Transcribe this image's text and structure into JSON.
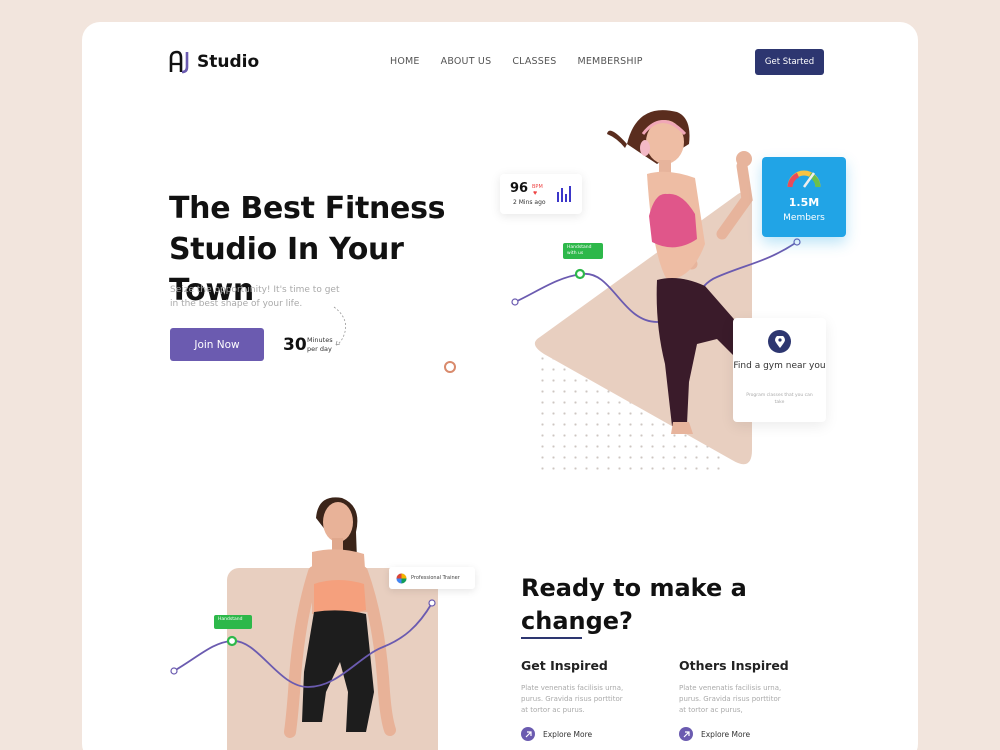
{
  "brand": {
    "name": "Studio",
    "accent": "#6b5bb0",
    "navy": "#2d3670",
    "background": "#f2e5dd"
  },
  "nav": {
    "items": [
      "HOME",
      "ABOUT US",
      "CLASSES",
      "MEMBERSHIP"
    ],
    "cta": "Get Started"
  },
  "hero": {
    "title": "The Best Fitness Studio In Your Town",
    "subtitle": "Seize the opportunity! It's time to get in the best shape of your life.",
    "join_label": "Join Now",
    "minutes_value": "30",
    "minutes_label": "Minutes per day"
  },
  "bpm_card": {
    "value": "96",
    "unit": "BPM",
    "time": "2 Mins ago"
  },
  "members_card": {
    "value": "1.5M",
    "label": "Members"
  },
  "gym_card": {
    "title": "Find a gym near you",
    "note": "Program classes that you can take"
  },
  "tags": {
    "hero_tag": "Handstand with us",
    "trainer": "Professional Trainer",
    "s2_tag": "Handstand"
  },
  "section2": {
    "title": "Ready to make a change?",
    "columns": [
      {
        "heading": "Get Inspired",
        "body": "Plate venenatis facilisis urna, purus. Gravida risus porttitor at tortor ac purus.",
        "link": "Explore More"
      },
      {
        "heading": "Others Inspired",
        "body": "Plate venenatis facilisis urna, purus. Gravida risus porttitor at tortor ac purus,",
        "link": "Explore More"
      }
    ]
  }
}
